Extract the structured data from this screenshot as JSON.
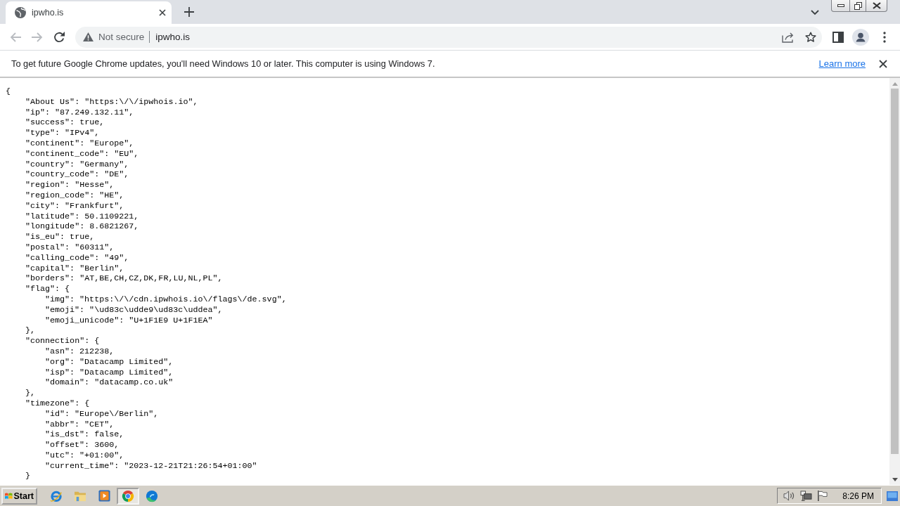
{
  "browser": {
    "tabs": [
      {
        "title": "ipwho.is",
        "selected": true
      }
    ],
    "nav": [
      {
        "kind": "back",
        "disabled": true
      },
      {
        "kind": "forward",
        "disabled": true
      },
      {
        "kind": "reload",
        "disabled": false
      }
    ],
    "omnibox": {
      "security_label": "Not secure",
      "url": "ipwho.is"
    }
  },
  "infobar": {
    "message": "To get future Google Chrome updates, you'll need Windows 10 or later. This computer is using Windows 7.",
    "link": "Learn more"
  },
  "document": {
    "lines": [
      {
        "text": "{",
        "children": [
          {
            "text": "\"About Us\": \"https:\\/\\/ipwhois.io\","
          },
          {
            "text": "\"ip\": \"87.249.132.11\","
          },
          {
            "text": "\"success\": true,"
          },
          {
            "text": "\"type\": \"IPv4\","
          },
          {
            "text": "\"continent\": \"Europe\","
          },
          {
            "text": "\"continent_code\": \"EU\","
          },
          {
            "text": "\"country\": \"Germany\","
          },
          {
            "text": "\"country_code\": \"DE\","
          },
          {
            "text": "\"region\": \"Hesse\","
          },
          {
            "text": "\"region_code\": \"HE\","
          },
          {
            "text": "\"city\": \"Frankfurt\","
          },
          {
            "text": "\"latitude\": 50.1109221,"
          },
          {
            "text": "\"longitude\": 8.6821267,"
          },
          {
            "text": "\"is_eu\": true,"
          },
          {
            "text": "\"postal\": \"60311\","
          },
          {
            "text": "\"calling_code\": \"49\","
          },
          {
            "text": "\"capital\": \"Berlin\","
          },
          {
            "text": "\"borders\": \"AT,BE,CH,CZ,DK,FR,LU,NL,PL\","
          },
          {
            "text": "\"flag\": {",
            "children": [
              {
                "text": "\"img\": \"https:\\/\\/cdn.ipwhois.io\\/flags\\/de.svg\","
              },
              {
                "text": "\"emoji\": \"\\ud83c\\udde9\\ud83c\\uddea\","
              },
              {
                "text": "\"emoji_unicode\": \"U+1F1E9 U+1F1EA\""
              }
            ]
          },
          {
            "text": "},"
          },
          {
            "text": "\"connection\": {",
            "children": [
              {
                "text": "\"asn\": 212238,"
              },
              {
                "text": "\"org\": \"Datacamp Limited\","
              },
              {
                "text": "\"isp\": \"Datacamp Limited\","
              },
              {
                "text": "\"domain\": \"datacamp.co.uk\""
              }
            ]
          },
          {
            "text": "},"
          },
          {
            "text": "\"timezone\": {",
            "children": [
              {
                "text": "\"id\": \"Europe\\/Berlin\","
              },
              {
                "text": "\"abbr\": \"CET\","
              },
              {
                "text": "\"is_dst\": false,"
              },
              {
                "text": "\"offset\": 3600,"
              },
              {
                "text": "\"utc\": \"+01:00\","
              },
              {
                "text": "\"current_time\": \"2023-12-21T21:26:54+01:00\""
              }
            ]
          },
          {
            "text": "}"
          }
        ]
      }
    ]
  },
  "taskbar": {
    "start": "Start",
    "apps": [
      {
        "kind": "explorer",
        "selected": false
      },
      {
        "kind": "folder",
        "selected": false
      },
      {
        "kind": "player",
        "selected": false
      },
      {
        "kind": "chrome",
        "selected": true
      },
      {
        "kind": "edge",
        "selected": false
      }
    ],
    "clock": "8:26 PM"
  }
}
